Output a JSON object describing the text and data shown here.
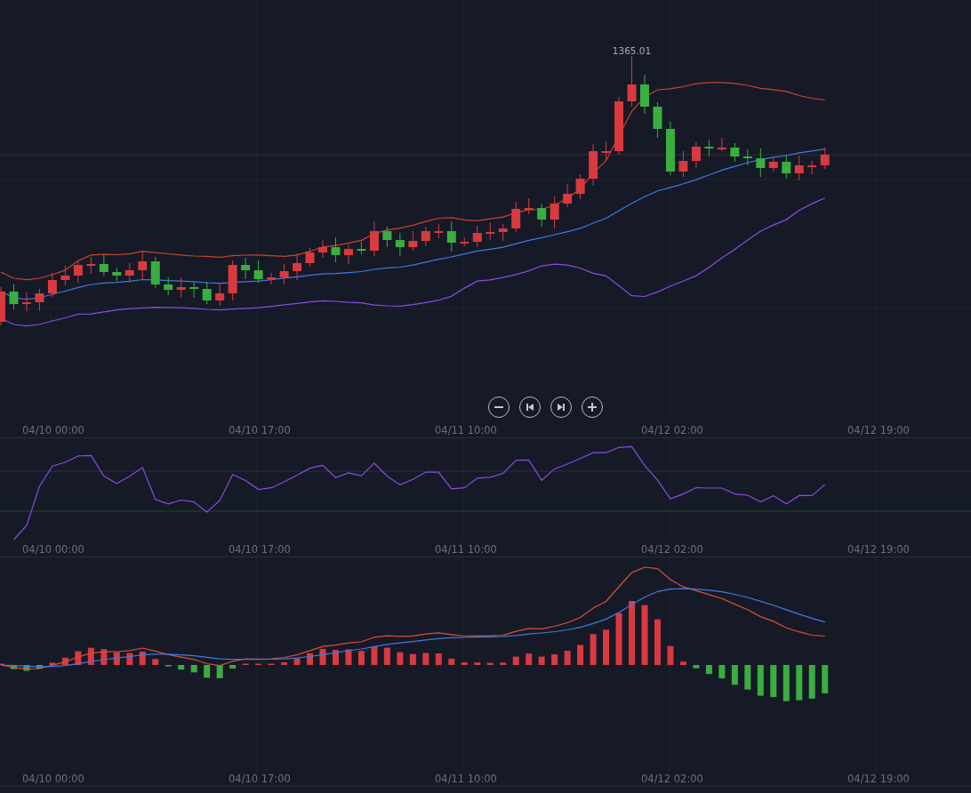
{
  "price_chart": {
    "max_label": "1365.01",
    "axis_labels": [
      "04/10 00:00",
      "04/10 17:00",
      "04/11 10:00",
      "04/12 02:00",
      "04/12 19:00"
    ]
  },
  "zoom_controls": [
    {
      "kind": "zoom-out"
    },
    {
      "kind": "first"
    },
    {
      "kind": "last"
    },
    {
      "kind": "zoom-in"
    }
  ],
  "rsi_panel": {
    "axis_labels": [
      "04/10 00:00",
      "04/10 17:00",
      "04/11 10:00",
      "04/12 02:00",
      "04/12 19:00"
    ]
  },
  "macd_panel": {
    "axis_labels": [
      "04/10 00:00",
      "04/10 17:00",
      "04/11 10:00",
      "04/12 02:00",
      "04/12 19:00"
    ]
  }
}
